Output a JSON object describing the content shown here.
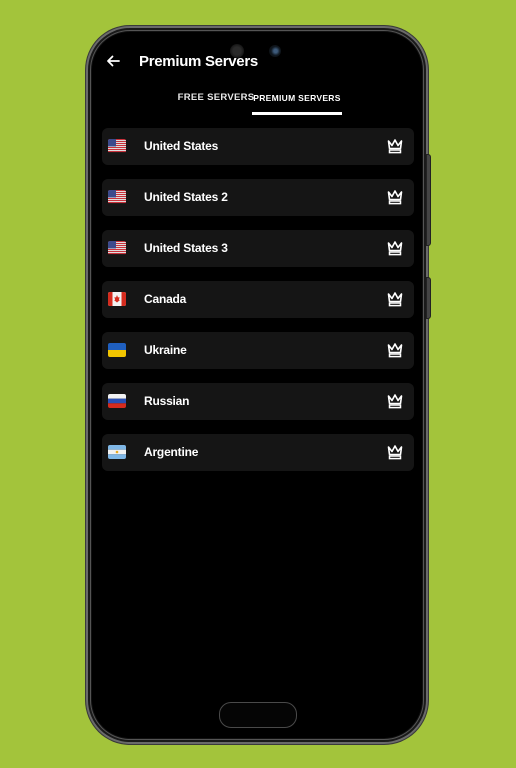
{
  "app": {
    "title": "Premium Servers",
    "back_icon": "arrow-left-icon"
  },
  "tabs": [
    {
      "label": "FREE SERVERS",
      "selected": false
    },
    {
      "label": "PREMIUM SERVERS",
      "selected": true
    }
  ],
  "servers": [
    {
      "name": "United States",
      "flag": "us",
      "icon": "crown-icon"
    },
    {
      "name": "United States 2",
      "flag": "us",
      "icon": "crown-icon"
    },
    {
      "name": "United States 3",
      "flag": "us",
      "icon": "crown-icon"
    },
    {
      "name": "Canada",
      "flag": "ca",
      "icon": "crown-icon"
    },
    {
      "name": "Ukraine",
      "flag": "ua",
      "icon": "crown-icon"
    },
    {
      "name": "Russian",
      "flag": "ru",
      "icon": "crown-icon"
    },
    {
      "name": "Argentine",
      "flag": "ar",
      "icon": "crown-icon"
    }
  ],
  "colors": {
    "background": "#a3c43b",
    "screen": "#000000",
    "row": "#151515",
    "text": "#ffffff"
  }
}
